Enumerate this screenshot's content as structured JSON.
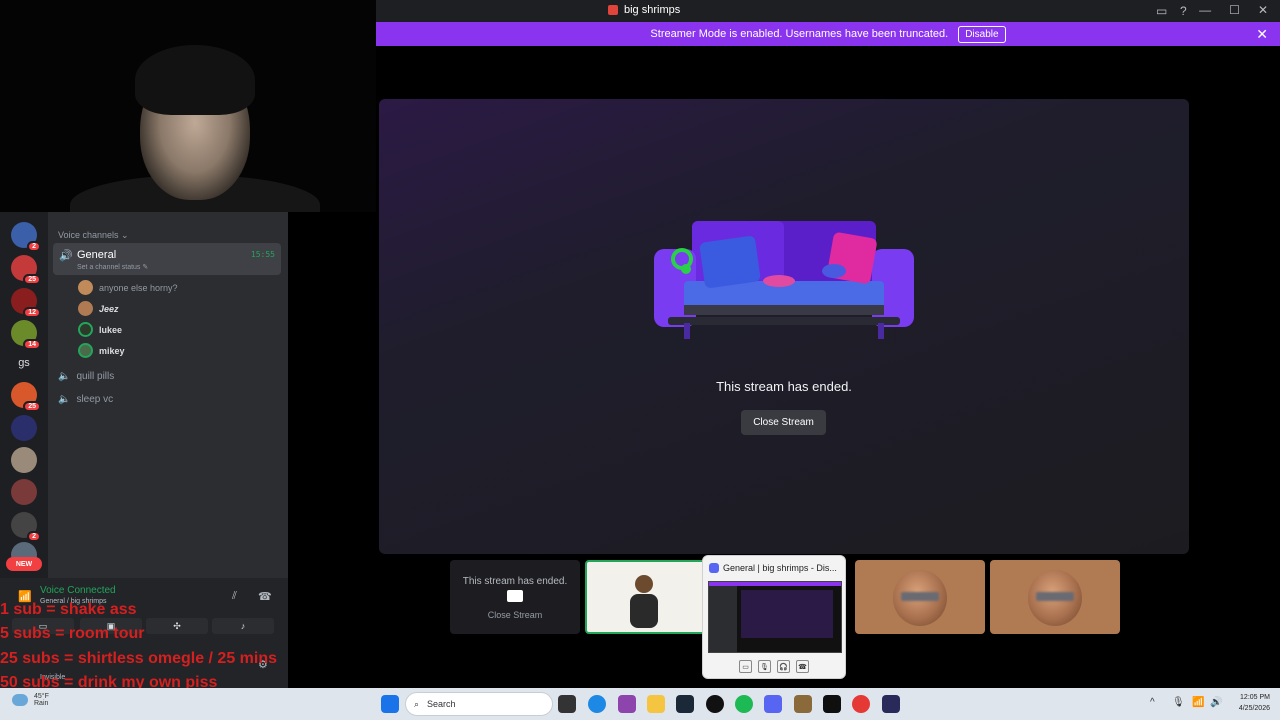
{
  "window": {
    "title": "big shrimps"
  },
  "banner": {
    "text": "Streamer Mode is enabled. Usernames have been truncated.",
    "disable_label": "Disable",
    "close_glyph": "✕"
  },
  "server_list": {
    "text_server": "gs",
    "new_label": "NEW",
    "badges": [
      "2",
      "25",
      "12",
      "14",
      "25",
      "2"
    ]
  },
  "channels": {
    "voice_header": "Voice channels",
    "active": {
      "name": "General",
      "status": "Set a channel status",
      "time": "15:55"
    },
    "members": [
      {
        "name": "anyone else horny?"
      },
      {
        "name": "Jeez"
      },
      {
        "name": "lukee"
      },
      {
        "name": "mikey"
      }
    ],
    "other": [
      {
        "name": "quill pills"
      },
      {
        "name": "sleep vc"
      }
    ]
  },
  "voice_panel": {
    "status": "Voice Connected",
    "location": "General / big shrimps",
    "user_label": "Invisible"
  },
  "overlay_text": [
    "1 sub = shake ass",
    "5 subs = room tour",
    "25 subs = shirtless omegle / 25 mins",
    "50 subs = drink my own piss"
  ],
  "stage": {
    "ended_text": "This stream has ended.",
    "close_label": "Close Stream"
  },
  "tiles": {
    "first_text": "This stream has ended.",
    "first_close": "Close Stream"
  },
  "preview": {
    "title": "General | big shrimps - Dis..."
  },
  "taskbar": {
    "temp": "45°F",
    "weather": "Rain",
    "search_placeholder": "Search",
    "time": "12:05 PM",
    "date": "4/25/2026"
  },
  "colors": {
    "banner": "#8a34f0",
    "connected": "#23a55a",
    "overlay_red": "#d61f1f"
  }
}
